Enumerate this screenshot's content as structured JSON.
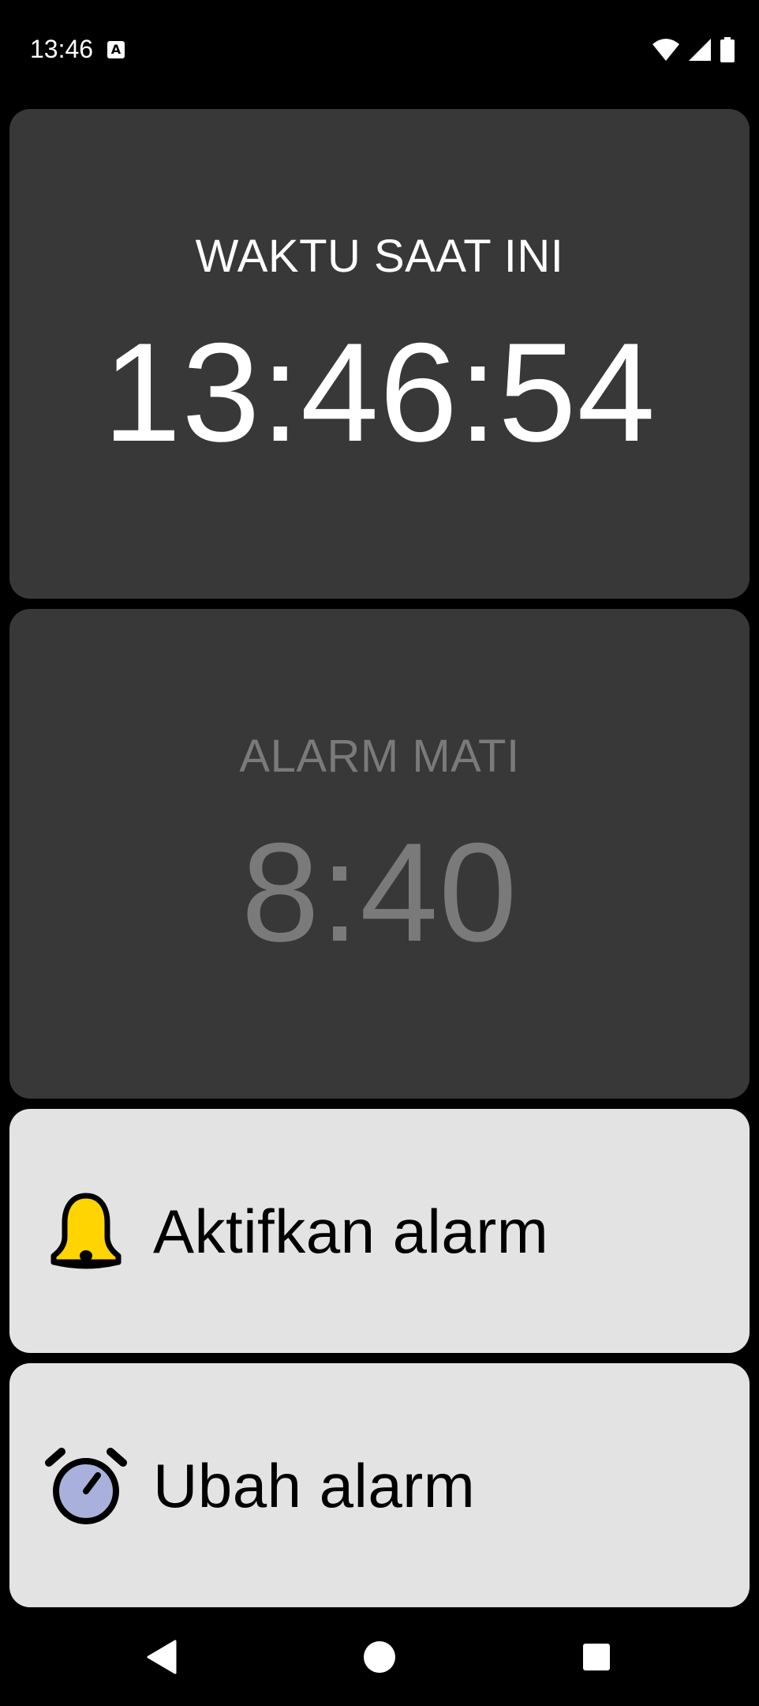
{
  "status_bar": {
    "time": "13:46",
    "notification_icon": "a-letter-icon",
    "wifi_icon": "wifi-icon",
    "signal_icon": "signal-icon",
    "battery_icon": "battery-icon"
  },
  "clock_card": {
    "label": "WAKTU SAAT INI",
    "time": "13:46:54"
  },
  "alarm_card": {
    "label": "ALARM MATI",
    "time": "8:40"
  },
  "actions": {
    "activate": {
      "label": "Aktifkan alarm",
      "icon": "bell-icon",
      "icon_color": "#ffd400"
    },
    "change": {
      "label": "Ubah alarm",
      "icon": "alarm-clock-icon",
      "icon_color": "#aab0dc"
    }
  },
  "nav_bar": {
    "back_icon": "back-triangle-icon",
    "home_icon": "home-circle-icon",
    "recents_icon": "recents-square-icon"
  },
  "colors": {
    "background": "#000000",
    "card_dark": "#383838",
    "card_light": "#e3e3e3",
    "text_primary": "#ffffff",
    "text_muted": "#7a7a7a"
  }
}
